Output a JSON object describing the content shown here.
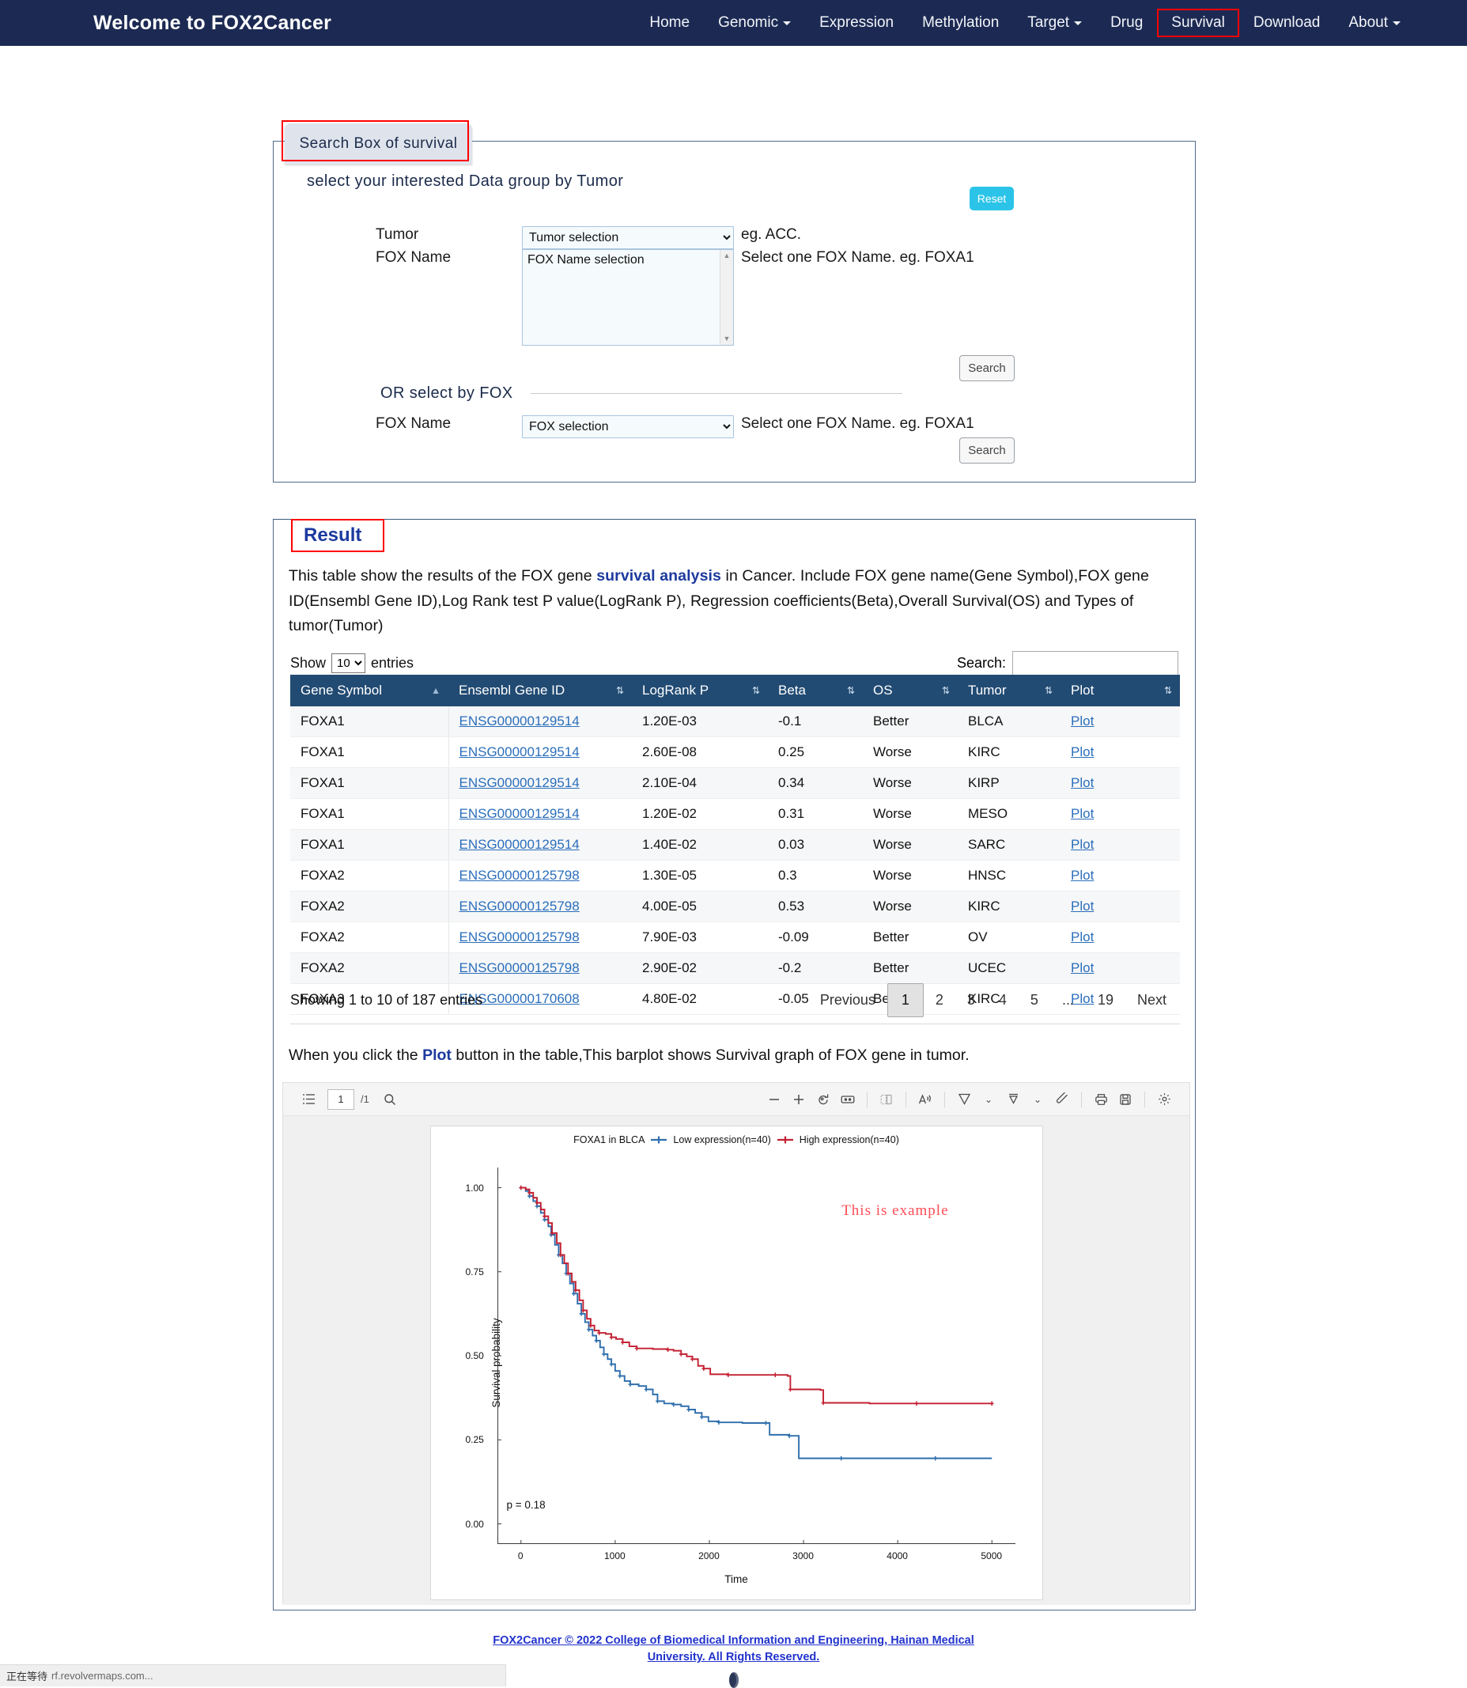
{
  "navbar": {
    "brand": "Welcome to FOX2Cancer",
    "links": [
      {
        "label": "Home",
        "caret": false,
        "highlight": false
      },
      {
        "label": "Genomic",
        "caret": true,
        "highlight": false
      },
      {
        "label": "Expression",
        "caret": false,
        "highlight": false
      },
      {
        "label": "Methylation",
        "caret": false,
        "highlight": false
      },
      {
        "label": "Target",
        "caret": true,
        "highlight": false
      },
      {
        "label": "Drug",
        "caret": false,
        "highlight": false
      },
      {
        "label": "Survival",
        "caret": false,
        "highlight": true
      },
      {
        "label": "Download",
        "caret": false,
        "highlight": false
      },
      {
        "label": "About",
        "caret": true,
        "highlight": false
      }
    ]
  },
  "search_box": {
    "legend": "Search Box of survival",
    "subtitle": "select your interested Data group by Tumor",
    "tumor_label": "Tumor",
    "tumor_select_value": "Tumor selection",
    "tumor_hint": "eg. ACC.",
    "foxname_label": "FOX Name",
    "foxname_list_value": "FOX Name selection",
    "foxname_hint": "Select one FOX Name. eg. FOXA1",
    "reset_label": "Reset",
    "search_label": "Search",
    "or_title": "OR select by FOX",
    "fox_label": "FOX Name",
    "fox_select_value": "FOX selection",
    "fox_hint": "Select one FOX Name. eg. FOXA1",
    "search2_label": "Search"
  },
  "result": {
    "legend": "Result",
    "description_prefix": "This table show the results of the FOX gene ",
    "description_bold": "survival analysis",
    "description_suffix": " in Cancer. Include FOX gene name(Gene Symbol),FOX gene ID(Ensembl Gene ID),Log Rank test P value(LogRank P), Regression coefficients(Beta),Overall Survival(OS) and Types of tumor(Tumor)",
    "show_label": "Show",
    "entries_label": "entries",
    "page_length": "10",
    "search_label": "Search:",
    "search_value": "",
    "columns": [
      "Gene Symbol",
      "Ensembl Gene ID",
      "LogRank P",
      "Beta",
      "OS",
      "Tumor",
      "Plot"
    ],
    "rows": [
      {
        "gene": "FOXA1",
        "ensembl": "ENSG00000129514",
        "logrank": "1.20E-03",
        "beta": "-0.1",
        "os": "Better",
        "tumor": "BLCA",
        "plot": "Plot"
      },
      {
        "gene": "FOXA1",
        "ensembl": "ENSG00000129514",
        "logrank": "2.60E-08",
        "beta": "0.25",
        "os": "Worse",
        "tumor": "KIRC",
        "plot": "Plot"
      },
      {
        "gene": "FOXA1",
        "ensembl": "ENSG00000129514",
        "logrank": "2.10E-04",
        "beta": "0.34",
        "os": "Worse",
        "tumor": "KIRP",
        "plot": "Plot"
      },
      {
        "gene": "FOXA1",
        "ensembl": "ENSG00000129514",
        "logrank": "1.20E-02",
        "beta": "0.31",
        "os": "Worse",
        "tumor": "MESO",
        "plot": "Plot"
      },
      {
        "gene": "FOXA1",
        "ensembl": "ENSG00000129514",
        "logrank": "1.40E-02",
        "beta": "0.03",
        "os": "Worse",
        "tumor": "SARC",
        "plot": "Plot"
      },
      {
        "gene": "FOXA2",
        "ensembl": "ENSG00000125798",
        "logrank": "1.30E-05",
        "beta": "0.3",
        "os": "Worse",
        "tumor": "HNSC",
        "plot": "Plot"
      },
      {
        "gene": "FOXA2",
        "ensembl": "ENSG00000125798",
        "logrank": "4.00E-05",
        "beta": "0.53",
        "os": "Worse",
        "tumor": "KIRC",
        "plot": "Plot"
      },
      {
        "gene": "FOXA2",
        "ensembl": "ENSG00000125798",
        "logrank": "7.90E-03",
        "beta": "-0.09",
        "os": "Better",
        "tumor": "OV",
        "plot": "Plot"
      },
      {
        "gene": "FOXA2",
        "ensembl": "ENSG00000125798",
        "logrank": "2.90E-02",
        "beta": "-0.2",
        "os": "Better",
        "tumor": "UCEC",
        "plot": "Plot"
      },
      {
        "gene": "FOXA3",
        "ensembl": "ENSG00000170608",
        "logrank": "4.80E-02",
        "beta": "-0.05",
        "os": "Better",
        "tumor": "KIRC",
        "plot": "Plot"
      }
    ],
    "info": "Showing 1 to 10 of 187 entries",
    "pagination": {
      "previous": "Previous",
      "pages": [
        "1",
        "2",
        "3",
        "4",
        "5",
        "...",
        "19"
      ],
      "current": "1",
      "next": "Next"
    },
    "plot_note_prefix": "When you click the ",
    "plot_note_bold": "Plot",
    "plot_note_suffix": " button in the table,This barplot shows Survival graph of FOX gene in tumor."
  },
  "pdf_viewer": {
    "page_current": "1",
    "page_total": "/1",
    "icons": [
      "list-toc-icon",
      "search-icon",
      "zoom-out-icon",
      "zoom-in-icon",
      "rotate-icon",
      "fit-page-icon",
      "two-page-icon",
      "read-aloud-icon",
      "draw-icon",
      "chevron-down-icon",
      "highlight-icon",
      "chevron-down-icon2",
      "erase-icon",
      "print-icon",
      "save-icon",
      "settings-icon"
    ]
  },
  "chart_data": {
    "type": "line",
    "title": "FOXA1 in BLCA",
    "legend": [
      {
        "name": "Low  expression(n=40)",
        "color": "#2f6fad"
      },
      {
        "name": "High expression(n=40)",
        "color": "#c32032"
      }
    ],
    "xlabel": "Time",
    "ylabel": "Survival probability",
    "xlim": [
      -250,
      5250
    ],
    "ylim": [
      -0.06,
      1.06
    ],
    "xticks": [
      0,
      1000,
      2000,
      3000,
      4000,
      5000
    ],
    "yticks": [
      0.0,
      0.25,
      0.5,
      0.75,
      1.0
    ],
    "ytick_labels": [
      "0.00",
      "0.25",
      "0.50",
      "0.75",
      "1.00"
    ],
    "xtick_labels": [
      "0",
      "1000",
      "2000",
      "3000",
      "4000",
      "5000"
    ],
    "annotation": "p = 0.18",
    "watermark": "This is  example",
    "watermark_color": "#ff4d55",
    "grid": false,
    "series": [
      {
        "name": "Low  expression(n=40)",
        "color": "#2f6fad",
        "points": [
          [
            0,
            1.0
          ],
          [
            50,
            0.99
          ],
          [
            90,
            0.975
          ],
          [
            130,
            0.96
          ],
          [
            170,
            0.945
          ],
          [
            210,
            0.925
          ],
          [
            250,
            0.905
          ],
          [
            290,
            0.885
          ],
          [
            320,
            0.86
          ],
          [
            360,
            0.83
          ],
          [
            400,
            0.8
          ],
          [
            440,
            0.775
          ],
          [
            480,
            0.745
          ],
          [
            520,
            0.715
          ],
          [
            560,
            0.685
          ],
          [
            600,
            0.655
          ],
          [
            640,
            0.625
          ],
          [
            680,
            0.6
          ],
          [
            720,
            0.578
          ],
          [
            760,
            0.56
          ],
          [
            800,
            0.545
          ],
          [
            840,
            0.525
          ],
          [
            880,
            0.505
          ],
          [
            920,
            0.49
          ],
          [
            960,
            0.475
          ],
          [
            1000,
            0.455
          ],
          [
            1050,
            0.44
          ],
          [
            1100,
            0.425
          ],
          [
            1160,
            0.415
          ],
          [
            1250,
            0.41
          ],
          [
            1330,
            0.4
          ],
          [
            1400,
            0.385
          ],
          [
            1450,
            0.365
          ],
          [
            1520,
            0.358
          ],
          [
            1620,
            0.355
          ],
          [
            1700,
            0.35
          ],
          [
            1780,
            0.34
          ],
          [
            1850,
            0.33
          ],
          [
            1920,
            0.318
          ],
          [
            1990,
            0.305
          ],
          [
            2100,
            0.302
          ],
          [
            2350,
            0.3
          ],
          [
            2600,
            0.3
          ],
          [
            2640,
            0.265
          ],
          [
            2850,
            0.262
          ],
          [
            2950,
            0.195
          ],
          [
            3400,
            0.195
          ],
          [
            3900,
            0.195
          ],
          [
            4400,
            0.195
          ],
          [
            5000,
            0.195
          ]
        ]
      },
      {
        "name": "High expression(n=40)",
        "color": "#c32032",
        "points": [
          [
            0,
            1.0
          ],
          [
            50,
            0.995
          ],
          [
            90,
            0.985
          ],
          [
            130,
            0.97
          ],
          [
            170,
            0.955
          ],
          [
            210,
            0.935
          ],
          [
            250,
            0.915
          ],
          [
            290,
            0.895
          ],
          [
            330,
            0.865
          ],
          [
            380,
            0.835
          ],
          [
            420,
            0.8
          ],
          [
            460,
            0.775
          ],
          [
            500,
            0.745
          ],
          [
            540,
            0.72
          ],
          [
            580,
            0.695
          ],
          [
            620,
            0.665
          ],
          [
            660,
            0.635
          ],
          [
            700,
            0.61
          ],
          [
            740,
            0.59
          ],
          [
            780,
            0.575
          ],
          [
            830,
            0.568
          ],
          [
            900,
            0.565
          ],
          [
            960,
            0.555
          ],
          [
            1010,
            0.55
          ],
          [
            1080,
            0.54
          ],
          [
            1150,
            0.528
          ],
          [
            1230,
            0.522
          ],
          [
            1400,
            0.52
          ],
          [
            1560,
            0.518
          ],
          [
            1620,
            0.515
          ],
          [
            1700,
            0.505
          ],
          [
            1760,
            0.498
          ],
          [
            1820,
            0.49
          ],
          [
            1880,
            0.47
          ],
          [
            1940,
            0.462
          ],
          [
            2010,
            0.445
          ],
          [
            2200,
            0.443
          ],
          [
            2450,
            0.443
          ],
          [
            2700,
            0.443
          ],
          [
            2830,
            0.44
          ],
          [
            2860,
            0.4
          ],
          [
            3180,
            0.398
          ],
          [
            3210,
            0.36
          ],
          [
            3700,
            0.358
          ],
          [
            4200,
            0.358
          ],
          [
            4700,
            0.358
          ],
          [
            5000,
            0.358
          ]
        ]
      }
    ]
  },
  "footer": {
    "text": "FOX2Cancer © 2022 College of Biomedical Information and Engineering, Hainan Medical University. All Rights Reserved."
  },
  "statusbar": {
    "wait": "正在等待",
    "url": "rf.revolvermaps.com..."
  }
}
